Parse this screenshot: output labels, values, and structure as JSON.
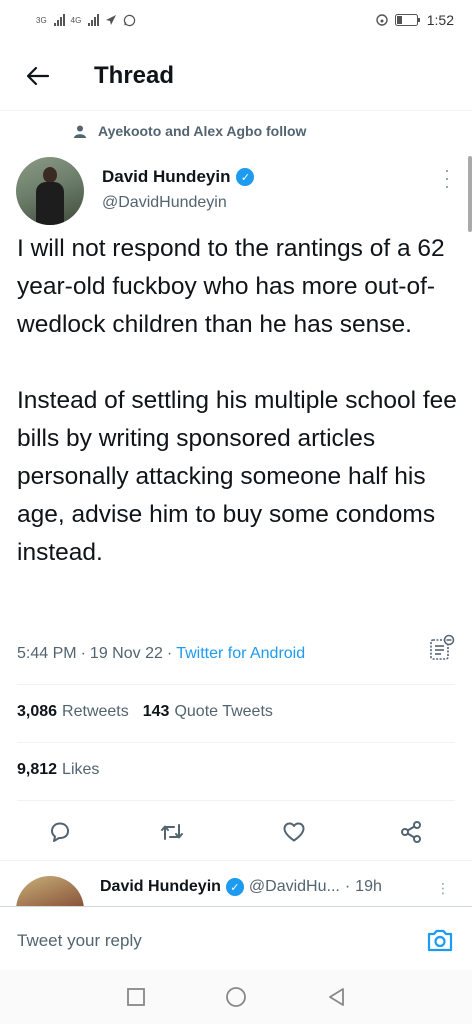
{
  "status_bar": {
    "network_1": "3G",
    "network_2": "4G",
    "time": "1:52"
  },
  "header": {
    "back_icon": "arrow-left-icon",
    "title": "Thread"
  },
  "social_context": {
    "icon": "person-icon",
    "text": "Ayekooto and Alex Agbo follow"
  },
  "tweet": {
    "author_name": "David Hundeyin",
    "verified_mark": "✓",
    "handle": "@DavidHundeyin",
    "text": "I will not respond to the rantings of a 62 year-old fuckboy who has more out-of-wedlock children than he has sense.\n\nInstead of settling his multiple school fee bills by writing sponsored articles personally attacking someone half his age, advise him to buy some condoms instead.",
    "time": "5:44 PM",
    "sep": "·",
    "date": "19 Nov 22",
    "source": "Twitter for Android",
    "retweets_count": "3,086",
    "retweets_label": "Retweets",
    "quotes_count": "143",
    "quotes_label": "Quote Tweets",
    "likes_count": "9,812",
    "likes_label": "Likes"
  },
  "actions": [
    "reply-icon",
    "retweet-icon",
    "like-icon",
    "share-icon"
  ],
  "reply_preview": {
    "author_name": "David Hundeyin",
    "verified_mark": "✓",
    "handle": "@DavidHu...",
    "sep": "·",
    "time": "19h"
  },
  "compose": {
    "placeholder": "Tweet your reply"
  },
  "colors": {
    "accent": "#1d9bf0",
    "text": "#0f1419",
    "muted": "#536471",
    "divider": "#eff3f4"
  }
}
